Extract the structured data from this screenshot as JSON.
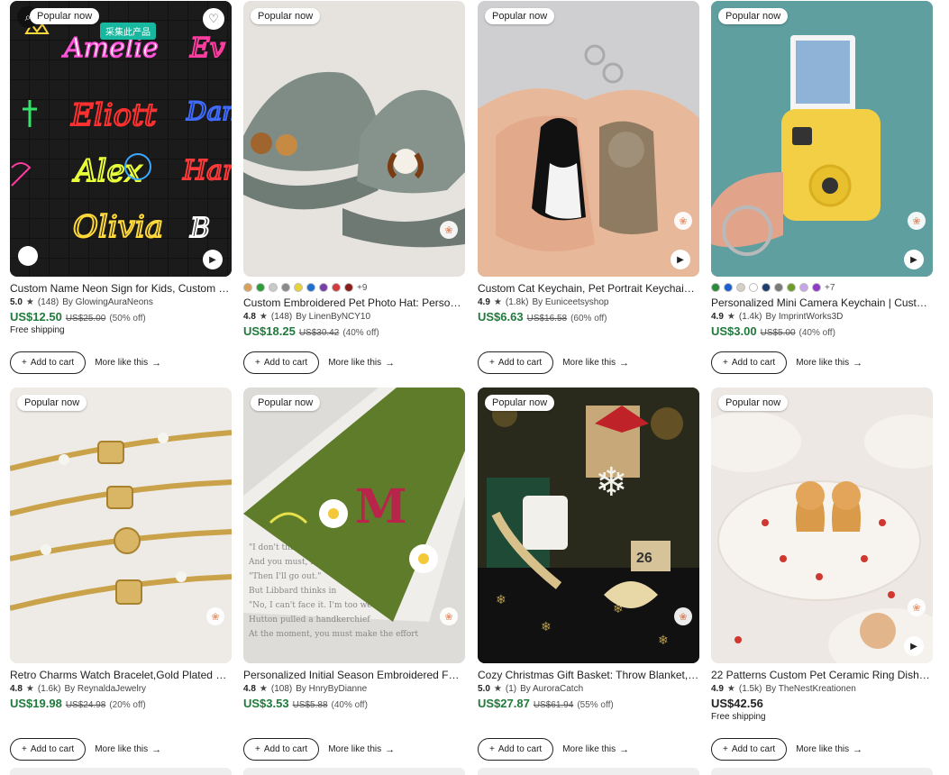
{
  "badges": {
    "popular": "Popular now",
    "collect": "采集此产品"
  },
  "actions": {
    "add_to_cart": "Add to cart",
    "more_like_this": "More like this"
  },
  "cards": [
    {
      "title": "Custom Name Neon Sign for Kids, Custom Le...",
      "rating": "5.0",
      "reviews": "(148)",
      "seller": "By GlowingAuraNeons",
      "price": "US$12.50",
      "old_price": "US$25.00",
      "discount": "(50% off)",
      "shipping": "Free shipping",
      "swatches": [],
      "more_colors": ""
    },
    {
      "title": "Custom Embroidered Pet Photo Hat: Personali...",
      "rating": "4.8",
      "reviews": "(148)",
      "seller": "By LinenByNCY10",
      "price": "US$18.25",
      "old_price": "US$30.42",
      "discount": "(40% off)",
      "shipping": "",
      "swatches": [
        "#d8a15a",
        "#2d9c3a",
        "#c9c9c9",
        "#8a8a8a",
        "#e6d23c",
        "#1e6fd0",
        "#7a3ea8",
        "#d23c3c",
        "#8a1c1c"
      ],
      "more_colors": "+9"
    },
    {
      "title": "Custom Cat Keychain, Pet Portrait Keychain, P...",
      "rating": "4.9",
      "reviews": "(1.8k)",
      "seller": "By Euniceetsyshop",
      "price": "US$6.63",
      "old_price": "US$16.58",
      "discount": "(60% off)",
      "shipping": "",
      "swatches": [],
      "more_colors": ""
    },
    {
      "title": "Personalized Mini Camera Keychain | Custom ...",
      "rating": "4.9",
      "reviews": "(1.4k)",
      "seller": "By ImprintWorks3D",
      "price": "US$3.00",
      "old_price": "US$5.00",
      "discount": "(40% off)",
      "shipping": "",
      "swatches": [
        "#2a8a3a",
        "#1e60d0",
        "#d6cfc4",
        "#ffffff",
        "#1c3d6e",
        "#7a7a7a",
        "#6e9c2a",
        "#c8a6e6",
        "#8e3cc8"
      ],
      "more_colors": "+7"
    },
    {
      "title": "Retro Charms Watch Bracelet,Gold Plated Pea...",
      "rating": "4.8",
      "reviews": "(1.6k)",
      "seller": "By ReynaldaJewelry",
      "price": "US$19.98",
      "old_price": "US$24.98",
      "discount": "(20% off)",
      "shipping": "",
      "swatches": [],
      "more_colors": ""
    },
    {
      "title": "Personalized Initial Season Embroidered Felt ...",
      "rating": "4.8",
      "reviews": "(108)",
      "seller": "By HnryByDianne",
      "price": "US$3.53",
      "old_price": "US$5.88",
      "discount": "(40% off)",
      "shipping": "",
      "swatches": [],
      "more_colors": ""
    },
    {
      "title": "Cozy Christmas Gift Basket: Throw Blanket, H...",
      "rating": "5.0",
      "reviews": "(1)",
      "seller": "By AuroraCatch",
      "price": "US$27.87",
      "old_price": "US$61.94",
      "discount": "(55% off)",
      "shipping": "",
      "swatches": [],
      "more_colors": ""
    },
    {
      "title": "22 Patterns Custom Pet Ceramic Ring Dish Per...",
      "rating": "4.9",
      "reviews": "(1.5k)",
      "seller": "By TheNestKreationen",
      "price": "US$42.56",
      "old_price": "",
      "discount": "",
      "shipping": "Free shipping",
      "swatches": [],
      "more_colors": ""
    }
  ],
  "icons": {
    "star": "star-icon",
    "play": "play-icon",
    "heart": "heart-icon",
    "plus": "plus-icon",
    "arrow": "arrow-right-icon",
    "zoom": "zoom-icon",
    "shop_badge": "etsy-badge-icon"
  },
  "colors": {
    "sale_price": "#1f7a3b",
    "text": "#222222"
  }
}
